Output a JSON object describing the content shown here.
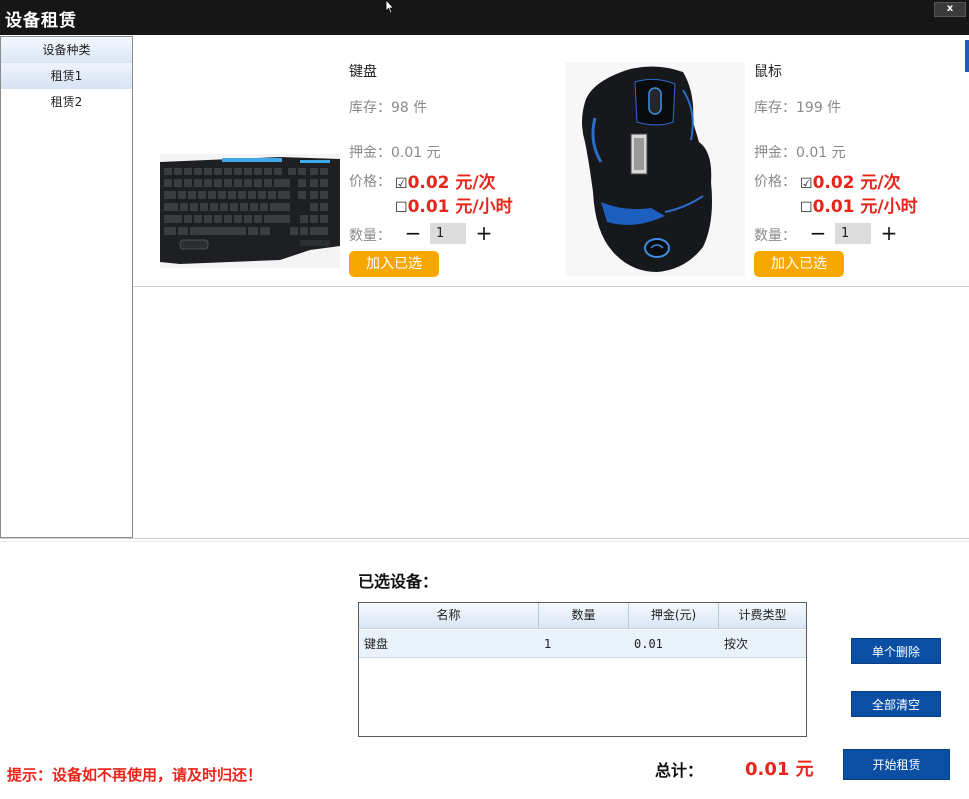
{
  "window": {
    "title": "设备租赁",
    "close_label": "x"
  },
  "sidebar": {
    "items": [
      {
        "label": "设备种类"
      },
      {
        "label": "租赁1"
      },
      {
        "label": "租赁2"
      }
    ]
  },
  "products": [
    {
      "name": "键盘",
      "stock": "库存：98 件",
      "deposit": "押金：0.01 元",
      "price_label": "价格：",
      "price_per_use": "0.02 元/次",
      "price_per_use_checked": "☑",
      "price_per_hour": "0.01 元/小时",
      "price_per_hour_checked": "☐",
      "qty_label": "数量：",
      "qty_minus": "−",
      "qty_value": "1",
      "qty_plus": "+",
      "add_label": "加入已选"
    },
    {
      "name": "鼠标",
      "stock": "库存：199 件",
      "deposit": "押金：0.01 元",
      "price_label": "价格：",
      "price_per_use": "0.02 元/次",
      "price_per_use_checked": "☑",
      "price_per_hour": "0.01 元/小时",
      "price_per_hour_checked": "☐",
      "qty_label": "数量：",
      "qty_minus": "−",
      "qty_value": "1",
      "qty_plus": "+",
      "add_label": "加入已选"
    }
  ],
  "selected": {
    "title": "已选设备：",
    "columns": [
      "名称",
      "数量",
      "押金(元)",
      "计费类型"
    ],
    "rows": [
      {
        "name": "键盘",
        "qty": "1",
        "deposit": "0.01",
        "type": "按次"
      }
    ]
  },
  "actions": {
    "delete_one": "单个删除",
    "clear_all": "全部清空",
    "start_rent": "开始租赁"
  },
  "footer": {
    "tip": "提示：设备如不再使用，请及时归还！",
    "total_label": "总计：",
    "total_value": "0.01 元"
  },
  "colors": {
    "accent_red": "#e8251b",
    "add_button": "#f7a800",
    "action_button": "#0b4fa4",
    "titlebar": "#161616"
  }
}
